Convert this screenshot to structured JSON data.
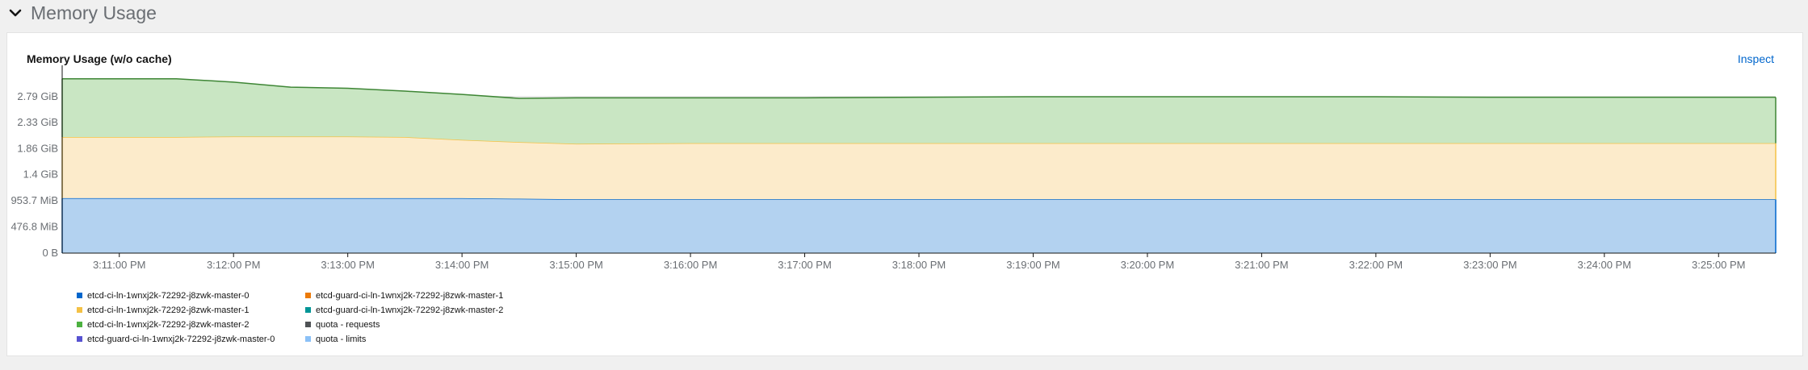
{
  "section": {
    "title": "Memory Usage"
  },
  "card": {
    "title": "Memory Usage (w/o cache)",
    "inspect_label": "Inspect"
  },
  "colors": {
    "master0_fill": "#b3d2f0",
    "master0_line": "#0066cc",
    "master1_fill": "#fcebcb",
    "master1_line": "#f4c145",
    "master2_fill": "#c9e6c3",
    "master2_line": "#3e8635",
    "axis": "#151515",
    "grid": "#d2d2d2",
    "tick_text": "#6a6e73"
  },
  "legend": [
    {
      "label": "etcd-ci-ln-1wnxj2k-72292-j8zwk-master-0",
      "color": "#0066cc"
    },
    {
      "label": "etcd-guard-ci-ln-1wnxj2k-72292-j8zwk-master-1",
      "color": "#ec7a08"
    },
    {
      "label": "etcd-ci-ln-1wnxj2k-72292-j8zwk-master-1",
      "color": "#f4c145"
    },
    {
      "label": "etcd-guard-ci-ln-1wnxj2k-72292-j8zwk-master-2",
      "color": "#009596"
    },
    {
      "label": "etcd-ci-ln-1wnxj2k-72292-j8zwk-master-2",
      "color": "#4cb140"
    },
    {
      "label": "quota - requests",
      "color": "#4f5255"
    },
    {
      "label": "etcd-guard-ci-ln-1wnxj2k-72292-j8zwk-master-0",
      "color": "#5752d1"
    },
    {
      "label": "quota - limits",
      "color": "#8bc1f7"
    }
  ],
  "chart_data": {
    "type": "area",
    "stacked": true,
    "title": "Memory Usage (w/o cache)",
    "xlabel": "",
    "ylabel": "",
    "ylim": [
      0,
      3.35
    ],
    "y_unit": "GiB",
    "y_ticks": [
      {
        "value": 0,
        "label": "0 B"
      },
      {
        "value": 0.4658,
        "label": "476.8 MiB"
      },
      {
        "value": 0.9314,
        "label": "953.7 MiB"
      },
      {
        "value": 1.4,
        "label": "1.4 GiB"
      },
      {
        "value": 1.86,
        "label": "1.86 GiB"
      },
      {
        "value": 2.33,
        "label": "2.33 GiB"
      },
      {
        "value": 2.79,
        "label": "2.79 GiB"
      }
    ],
    "xlim": [
      3.5,
      18.5
    ],
    "x_ticks": [
      {
        "value": 4,
        "label": "3:11:00 PM"
      },
      {
        "value": 5,
        "label": "3:12:00 PM"
      },
      {
        "value": 6,
        "label": "3:13:00 PM"
      },
      {
        "value": 7,
        "label": "3:14:00 PM"
      },
      {
        "value": 8,
        "label": "3:15:00 PM"
      },
      {
        "value": 9,
        "label": "3:16:00 PM"
      },
      {
        "value": 10,
        "label": "3:17:00 PM"
      },
      {
        "value": 11,
        "label": "3:18:00 PM"
      },
      {
        "value": 12,
        "label": "3:19:00 PM"
      },
      {
        "value": 13,
        "label": "3:20:00 PM"
      },
      {
        "value": 14,
        "label": "3:21:00 PM"
      },
      {
        "value": 15,
        "label": "3:22:00 PM"
      },
      {
        "value": 16,
        "label": "3:23:00 PM"
      },
      {
        "value": 17,
        "label": "3:24:00 PM"
      },
      {
        "value": 18,
        "label": "3:25:00 PM"
      }
    ],
    "x": [
      3.5,
      4,
      4.5,
      5,
      5.5,
      6,
      6.5,
      7,
      7.5,
      8,
      9,
      10,
      11,
      12,
      13,
      14,
      15,
      16,
      17,
      18,
      18.5
    ],
    "series": [
      {
        "name": "etcd-ci-ln-1wnxj2k-72292-j8zwk-master-0",
        "values": [
          0.98,
          0.98,
          0.98,
          0.98,
          0.98,
          0.98,
          0.98,
          0.98,
          0.97,
          0.96,
          0.96,
          0.96,
          0.96,
          0.96,
          0.96,
          0.96,
          0.96,
          0.96,
          0.96,
          0.96,
          0.96
        ]
      },
      {
        "name": "etcd-ci-ln-1wnxj2k-72292-j8zwk-master-1",
        "values": [
          1.09,
          1.09,
          1.09,
          1.1,
          1.1,
          1.1,
          1.09,
          1.04,
          1.01,
          0.99,
          1.0,
          1.0,
          1.0,
          1.0,
          1.0,
          1.0,
          1.0,
          1.0,
          1.0,
          1.0,
          1.0
        ]
      },
      {
        "name": "etcd-ci-ln-1wnxj2k-72292-j8zwk-master-2",
        "values": [
          1.04,
          1.04,
          1.04,
          0.97,
          0.88,
          0.86,
          0.82,
          0.81,
          0.78,
          0.82,
          0.81,
          0.81,
          0.82,
          0.83,
          0.83,
          0.83,
          0.83,
          0.82,
          0.82,
          0.82,
          0.82
        ]
      }
    ]
  }
}
